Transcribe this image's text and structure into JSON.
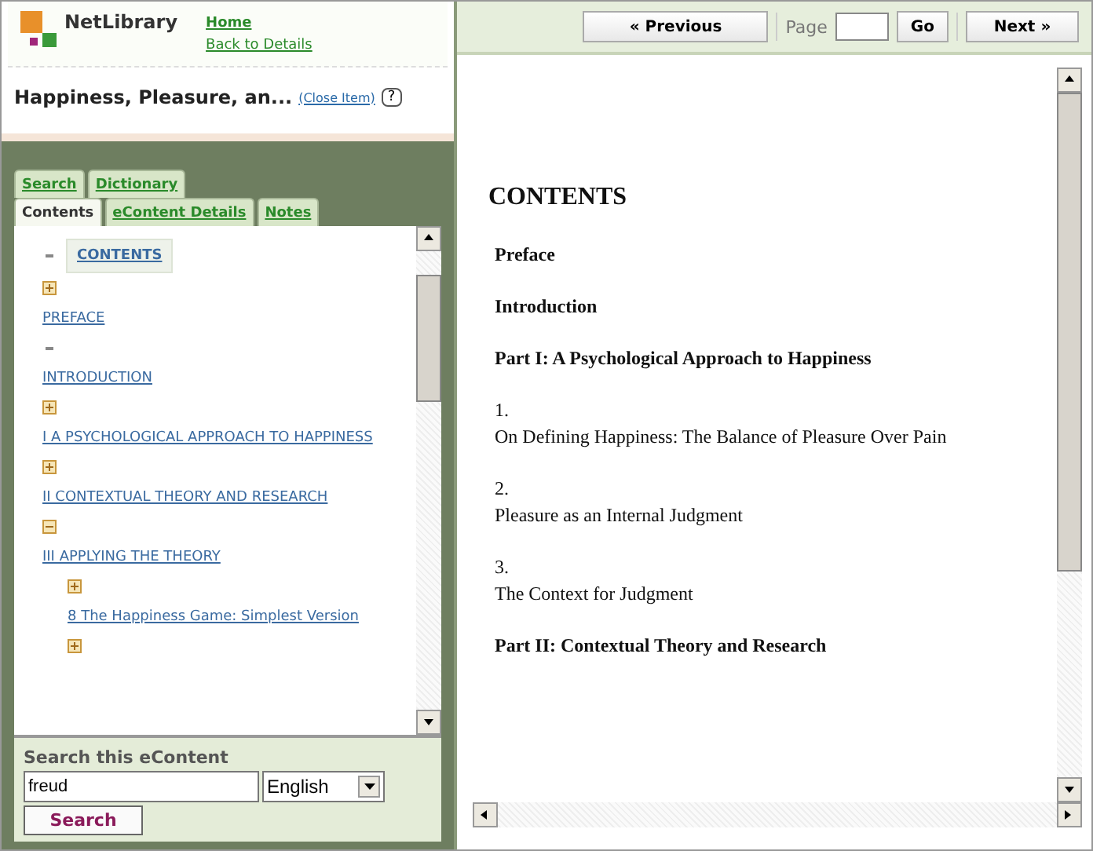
{
  "header": {
    "logo": "NetLibrary",
    "links": [
      "Home",
      "Back to Details"
    ]
  },
  "item": {
    "title": "Happiness, Pleasure, an...",
    "close": "(Close Item)",
    "help": "?"
  },
  "tabs_top": [
    {
      "label": "Search",
      "selected": false
    },
    {
      "label": "Dictionary",
      "selected": false
    }
  ],
  "tabs": [
    {
      "label": "Contents",
      "selected": true
    },
    {
      "label": "eContent Details",
      "selected": false
    },
    {
      "label": "Notes",
      "selected": false
    }
  ],
  "tree": [
    {
      "kind": "dash",
      "label": "CONTENTS",
      "selected": true,
      "children": [
        {
          "kind": "toggle",
          "expanded": false,
          "label": "PREFACE",
          "selected": false
        },
        {
          "kind": "dash",
          "label": "INTRODUCTION",
          "selected": false
        },
        {
          "kind": "toggle",
          "expanded": false,
          "label": "I A PSYCHOLOGICAL APPROACH TO HAPPINESS",
          "selected": false
        },
        {
          "kind": "toggle",
          "expanded": false,
          "label": "II CONTEXTUAL THEORY AND RESEARCH",
          "selected": false
        },
        {
          "kind": "toggle",
          "expanded": true,
          "label": "III APPLYING THE THEORY",
          "selected": false,
          "children": [
            {
              "kind": "toggle",
              "expanded": false,
              "label": "8 The Happiness Game: Simplest Version",
              "selected": false
            },
            {
              "kind": "toggle",
              "expanded": false
            }
          ]
        }
      ]
    }
  ],
  "search": {
    "heading": "Search this eContent",
    "value": "freud",
    "language": "English",
    "button": "Search"
  },
  "toolbar": {
    "previous": "« Previous",
    "page_label": "Page",
    "go": "Go",
    "next": "Next »"
  },
  "document": [
    {
      "kind": "title",
      "text": "CONTENTS"
    },
    {
      "kind": "entry",
      "text": "Preface"
    },
    {
      "kind": "entry",
      "text": "Introduction"
    },
    {
      "kind": "entry",
      "text": "Part I: A Psychological Approach to Happiness"
    },
    {
      "kind": "numbered",
      "number": "1.",
      "text": "On Defining Happiness: The Balance of Pleasure Over Pain"
    },
    {
      "kind": "numbered",
      "number": "2.",
      "text": "Pleasure as an Internal Judgment"
    },
    {
      "kind": "numbered",
      "number": "3.",
      "text": "The Context for Judgment"
    },
    {
      "kind": "entry",
      "text": "Part II: Contextual Theory and Research"
    }
  ]
}
